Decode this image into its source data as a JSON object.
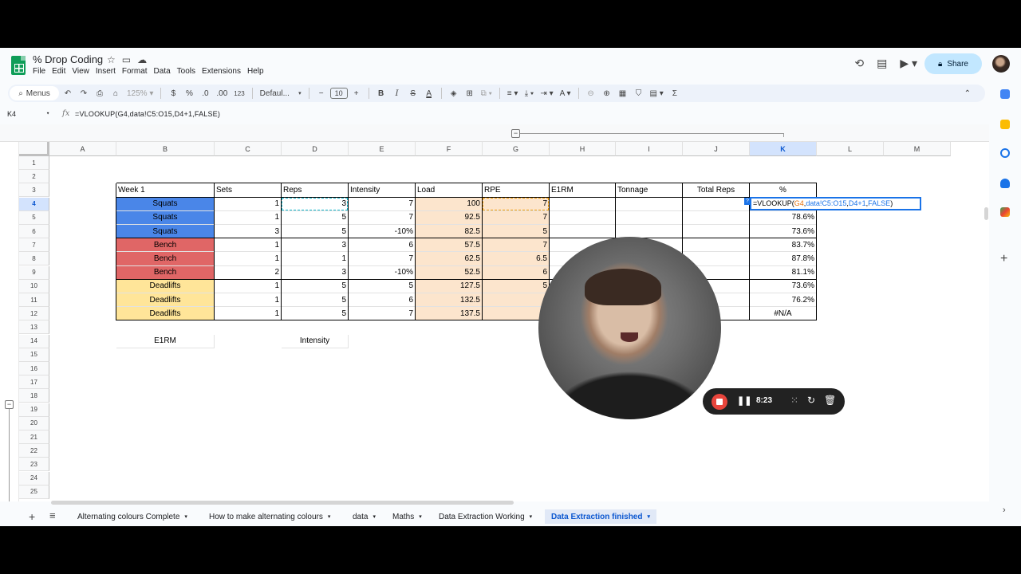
{
  "app": {
    "title": "% Drop Coding",
    "menu": [
      "File",
      "Edit",
      "View",
      "Insert",
      "Format",
      "Data",
      "Tools",
      "Extensions",
      "Help"
    ],
    "share_label": "Share"
  },
  "toolbar": {
    "menus_label": "Menus",
    "zoom": "125%",
    "currency": "$",
    "percent": "%",
    "decimal_dec": ".0",
    "decimal_inc": ".00",
    "number_format": "123",
    "font": "Defaul...",
    "font_size": "10",
    "bold": "B",
    "italic": "I",
    "strike": "S",
    "text_color": "A",
    "sigma": "Σ"
  },
  "formula_bar": {
    "cell_ref": "K4",
    "formula": "=VLOOKUP(G4,data!C5:O15,D4+1,FALSE)"
  },
  "columns": [
    "A",
    "B",
    "C",
    "D",
    "E",
    "F",
    "G",
    "H",
    "I",
    "J",
    "K",
    "L",
    "M"
  ],
  "rows": [
    "1",
    "2",
    "3",
    "4",
    "5",
    "6",
    "7",
    "8",
    "9",
    "10",
    "11",
    "12",
    "13",
    "14",
    "15",
    "16",
    "17",
    "18",
    "19",
    "20",
    "21",
    "22",
    "23",
    "24",
    "25"
  ],
  "selected_cell": {
    "col": "K",
    "row": "4"
  },
  "table": {
    "headers": [
      "Week 1",
      "Sets",
      "Reps",
      "Intensity",
      "Load",
      "RPE",
      "E1RM",
      "Tonnage",
      "Total Reps",
      "%"
    ],
    "rows": [
      {
        "exercise": "Squats",
        "sets": "1",
        "reps": "3",
        "intensity": "7",
        "load": "100",
        "rpe": "7",
        "pct": ""
      },
      {
        "exercise": "Squats",
        "sets": "1",
        "reps": "5",
        "intensity": "7",
        "load": "92.5",
        "rpe": "7",
        "pct": "78.6%"
      },
      {
        "exercise": "Squats",
        "sets": "3",
        "reps": "5",
        "intensity": "-10%",
        "load": "82.5",
        "rpe": "5",
        "pct": "73.6%"
      },
      {
        "exercise": "Bench",
        "sets": "1",
        "reps": "3",
        "intensity": "6",
        "load": "57.5",
        "rpe": "7",
        "pct": "83.7%"
      },
      {
        "exercise": "Bench",
        "sets": "1",
        "reps": "1",
        "intensity": "7",
        "load": "62.5",
        "rpe": "6.5",
        "pct": "87.8%"
      },
      {
        "exercise": "Bench",
        "sets": "2",
        "reps": "3",
        "intensity": "-10%",
        "load": "52.5",
        "rpe": "6",
        "pct": "81.1%"
      },
      {
        "exercise": "Deadlifts",
        "sets": "1",
        "reps": "5",
        "intensity": "5",
        "load": "127.5",
        "rpe": "5",
        "pct": "73.6%"
      },
      {
        "exercise": "Deadlifts",
        "sets": "1",
        "reps": "5",
        "intensity": "6",
        "load": "132.5",
        "rpe": "",
        "pct": "76.2%"
      },
      {
        "exercise": "Deadlifts",
        "sets": "1",
        "reps": "5",
        "intensity": "7",
        "load": "137.5",
        "rpe": "",
        "pct": "#N/A"
      }
    ],
    "editing_formula": {
      "prefix": "=VLOOKUP(",
      "ref1": "G4",
      "mid1": ",",
      "ref2": "data!C5:O15",
      "mid2": ",",
      "ref3": "D4+1",
      "mid3": ",",
      "ref4": "FALSE",
      "suffix": ")"
    },
    "label_e1rm": "E1RM",
    "label_intensity": "Intensity"
  },
  "colors": {
    "squats": "#4a86e8",
    "bench": "#e06666",
    "deadlifts": "#ffe599",
    "load_rpe": "#fce5cd",
    "accent": "#0b57d0",
    "share": "#c2e7ff"
  },
  "sheet_tabs": [
    {
      "label": "Alternating colours Complete"
    },
    {
      "label": "How to make alternating colours"
    },
    {
      "label": "data"
    },
    {
      "label": "Maths"
    },
    {
      "label": "Data Extraction Working"
    },
    {
      "label": "Data Extraction finished",
      "active": true
    }
  ],
  "recorder": {
    "time": "8:23"
  }
}
